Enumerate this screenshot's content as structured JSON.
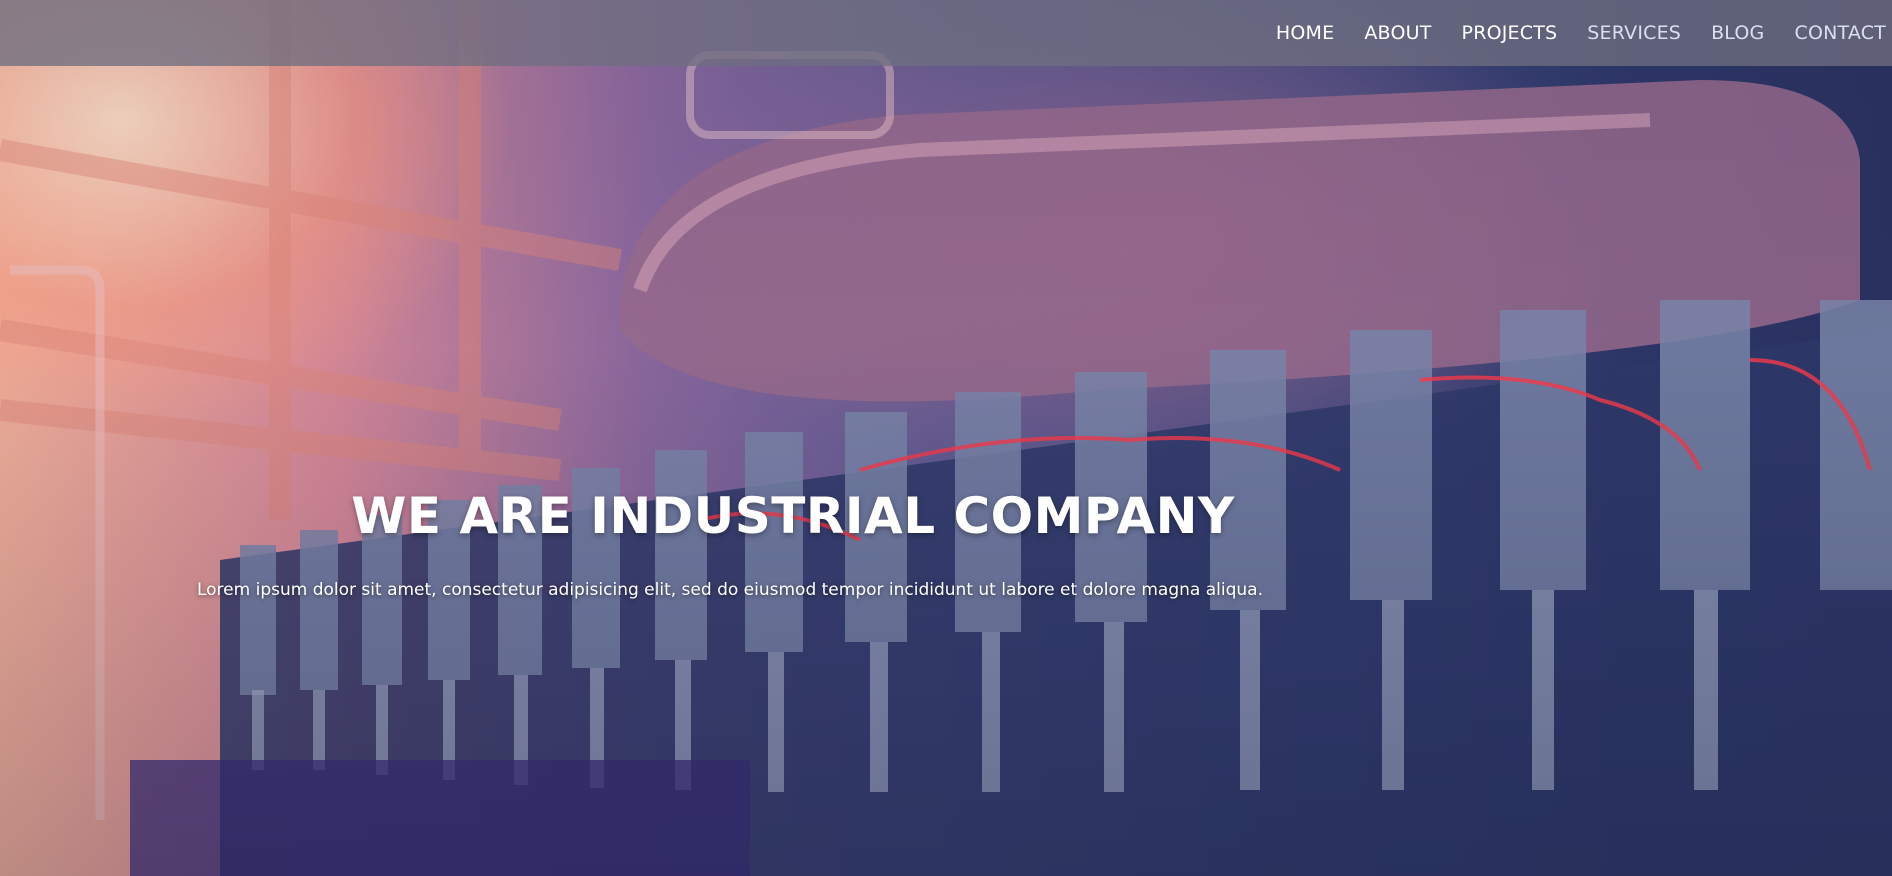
{
  "nav": {
    "items": [
      {
        "label": "HOME"
      },
      {
        "label": "ABOUT"
      },
      {
        "label": "PROJECTS"
      },
      {
        "label": "SERVICES"
      },
      {
        "label": "BLOG"
      },
      {
        "label": "CONTACT"
      }
    ]
  },
  "hero": {
    "title": "WE ARE INDUSTRIAL COMPANY",
    "subtitle": "Lorem ipsum dolor sit amet, consectetur adipisicing elit, sed do eiusmod tempor incididunt ut labore et dolore magna aliqua."
  },
  "colors": {
    "nav_bg": "#6e6e80",
    "text": "#ffffff",
    "accent_warm": "#f6b39c",
    "accent_cool": "#2c3768"
  }
}
